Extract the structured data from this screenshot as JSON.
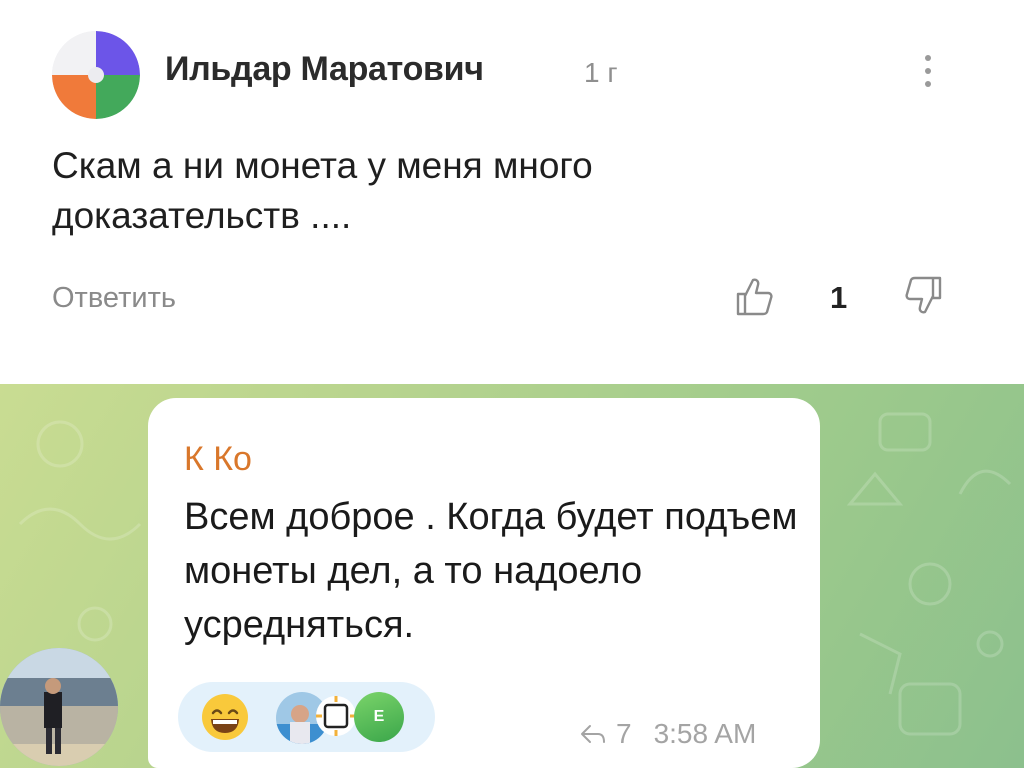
{
  "comment": {
    "author": "Ильдар Маратович",
    "time": "1 г",
    "text": "Скам а ни монета у меня много доказательств ....",
    "reply_label": "Ответить",
    "like_count": "1",
    "icons": [
      "avatar-logo",
      "more-vertical-icon",
      "thumbs-up-icon",
      "thumbs-down-icon"
    ]
  },
  "telegram": {
    "sender": "К Ко",
    "message": "Всем доброе . Когда будет подъем монеты дел, а то надоело усредняться.",
    "reaction_letter": "Е",
    "views": "7",
    "time": "3:58 AM",
    "icons": [
      "grinning-emoji",
      "forward-icon"
    ]
  },
  "colors": {
    "sender": "#d9772b",
    "reactions_bg": "#e3f1fb",
    "chat_bg_start": "#c9dc92",
    "chat_bg_end": "#8cc08d"
  }
}
